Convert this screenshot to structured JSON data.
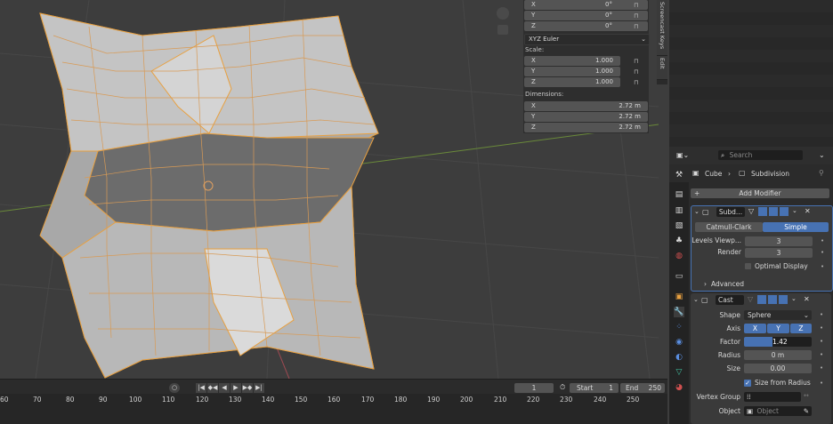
{
  "npanel": {
    "rotation": [
      {
        "axis": "X",
        "value": "0°"
      },
      {
        "axis": "Y",
        "value": "0°"
      },
      {
        "axis": "Z",
        "value": "0°"
      }
    ],
    "rotation_mode": "XYZ Euler",
    "scale_label": "Scale:",
    "scale": [
      {
        "axis": "X",
        "value": "1.000"
      },
      {
        "axis": "Y",
        "value": "1.000"
      },
      {
        "axis": "Z",
        "value": "1.000"
      }
    ],
    "dimensions_label": "Dimensions:",
    "dimensions": [
      {
        "axis": "X",
        "value": "2.72 m"
      },
      {
        "axis": "Y",
        "value": "2.72 m"
      },
      {
        "axis": "Z",
        "value": "2.72 m"
      }
    ],
    "tabs": [
      "Screencast Keys",
      "Edit"
    ]
  },
  "timeline": {
    "current_frame": "1",
    "start_label": "Start",
    "start": "1",
    "end_label": "End",
    "end": "250",
    "ruler": [
      "60",
      "70",
      "80",
      "90",
      "100",
      "110",
      "120",
      "130",
      "140",
      "150",
      "160",
      "170",
      "180",
      "190",
      "200",
      "210",
      "220",
      "230",
      "240",
      "250"
    ]
  },
  "properties": {
    "search_placeholder": "Search",
    "breadcrumb_object": "Cube",
    "breadcrumb_modifier": "Subdivision",
    "add_modifier": "Add Modifier",
    "subdiv": {
      "name": "Subd...",
      "catmull": "Catmull-Clark",
      "simple": "Simple",
      "levels_label": "Levels Viewp...",
      "levels": "3",
      "render_label": "Render",
      "render": "3",
      "optimal_display": "Optimal Display",
      "advanced": "Advanced"
    },
    "cast": {
      "name": "Cast",
      "shape_label": "Shape",
      "shape": "Sphere",
      "axis_label": "Axis",
      "axes": [
        "X",
        "Y",
        "Z"
      ],
      "factor_label": "Factor",
      "factor": "1.42",
      "radius_label": "Radius",
      "radius": "0 m",
      "size_label": "Size",
      "size": "0.00",
      "size_from_radius": "Size from Radius",
      "vertex_group_label": "Vertex Group",
      "object_label": "Object",
      "object_placeholder": "Object"
    }
  },
  "colors": {
    "accent": "#4772b3",
    "mesh": "#c8c8c8",
    "edge": "#e8a040"
  }
}
